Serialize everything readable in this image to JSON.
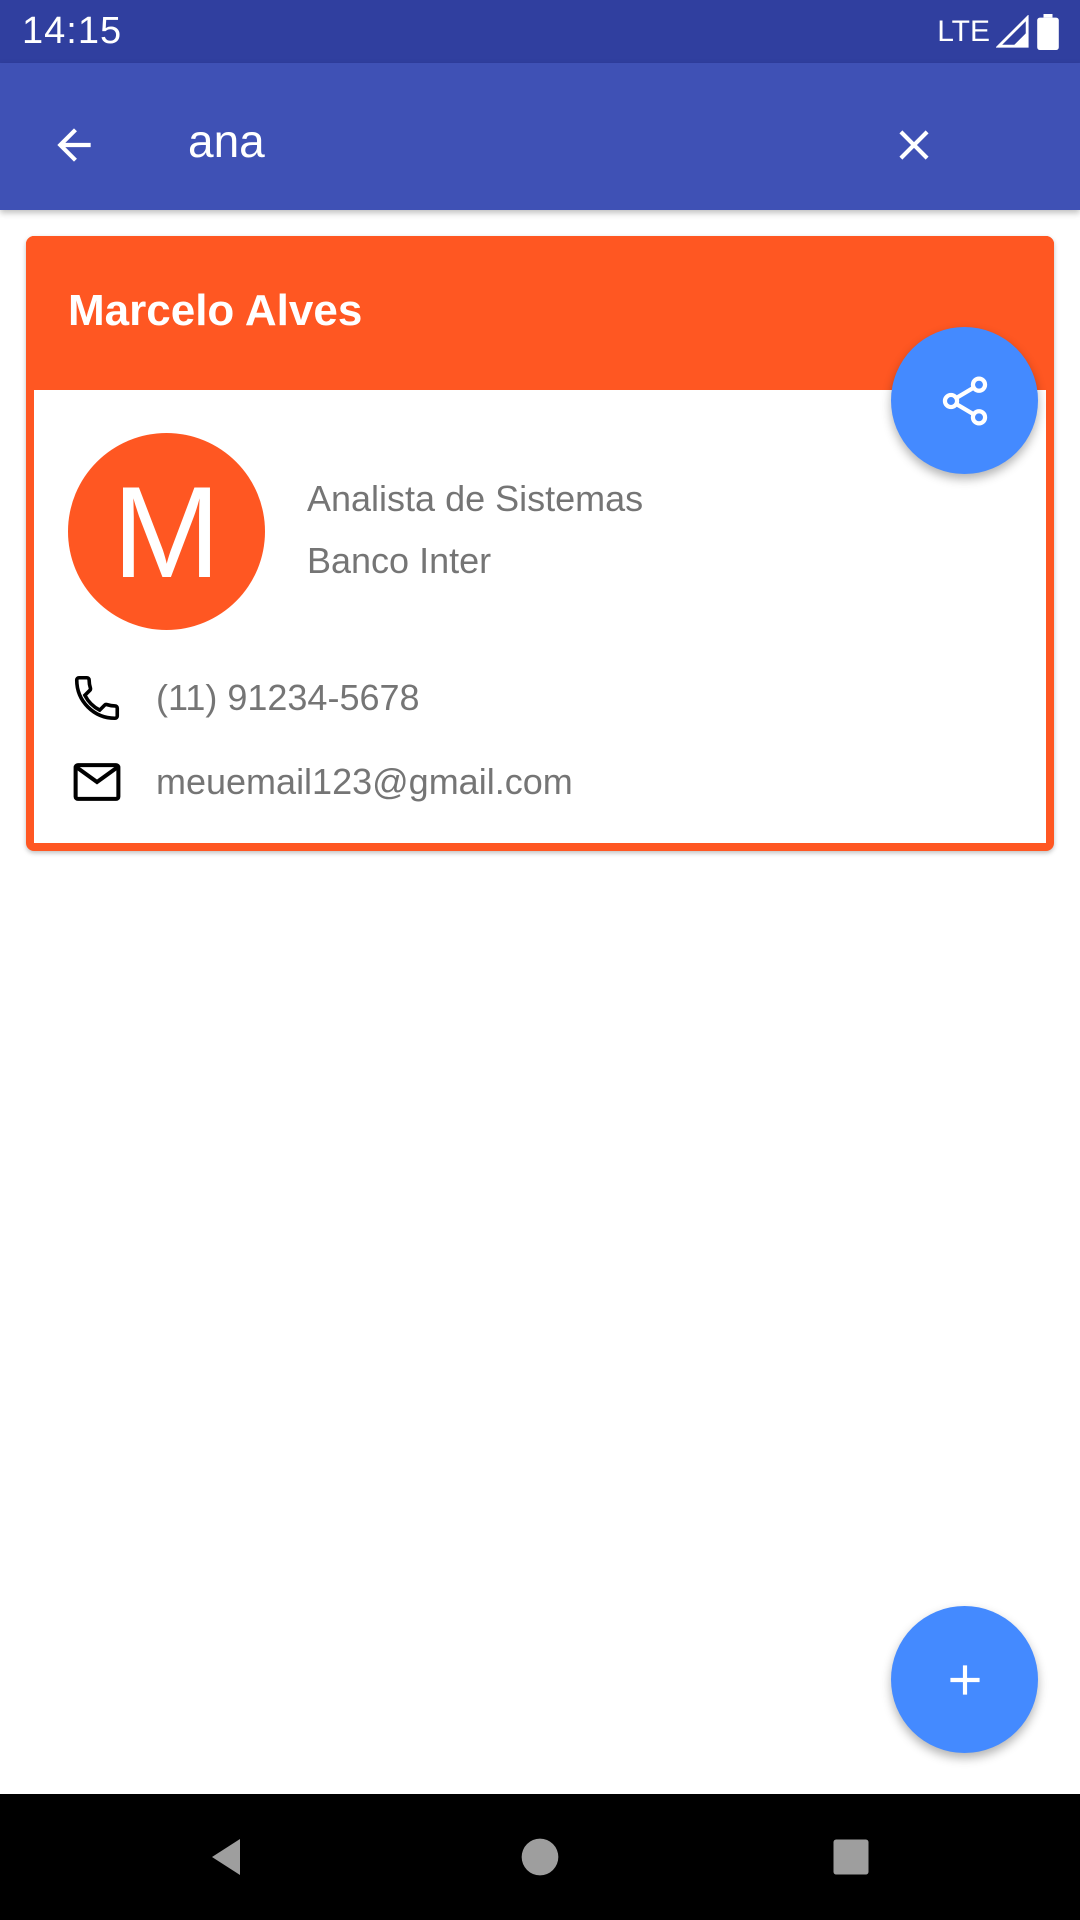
{
  "status_bar": {
    "time": "14:15",
    "network": "LTE"
  },
  "app_bar": {
    "search_value": "ana"
  },
  "contact_card": {
    "name": "Marcelo Alves",
    "avatar_letter": "M",
    "job_title": "Analista de Sistemas",
    "company": "Banco Inter",
    "phone": "(11) 91234-5678",
    "email": "meuemail123@gmail.com"
  },
  "icons": {
    "back": "arrow-left-icon",
    "clear": "close-icon",
    "share": "share-icon",
    "phone": "phone-icon",
    "email": "mail-icon",
    "add": "plus-icon"
  },
  "colors": {
    "status_bar": "#303f9f",
    "app_bar": "#3f51b5",
    "card_accent": "#ff5722",
    "fab": "#448aff"
  }
}
